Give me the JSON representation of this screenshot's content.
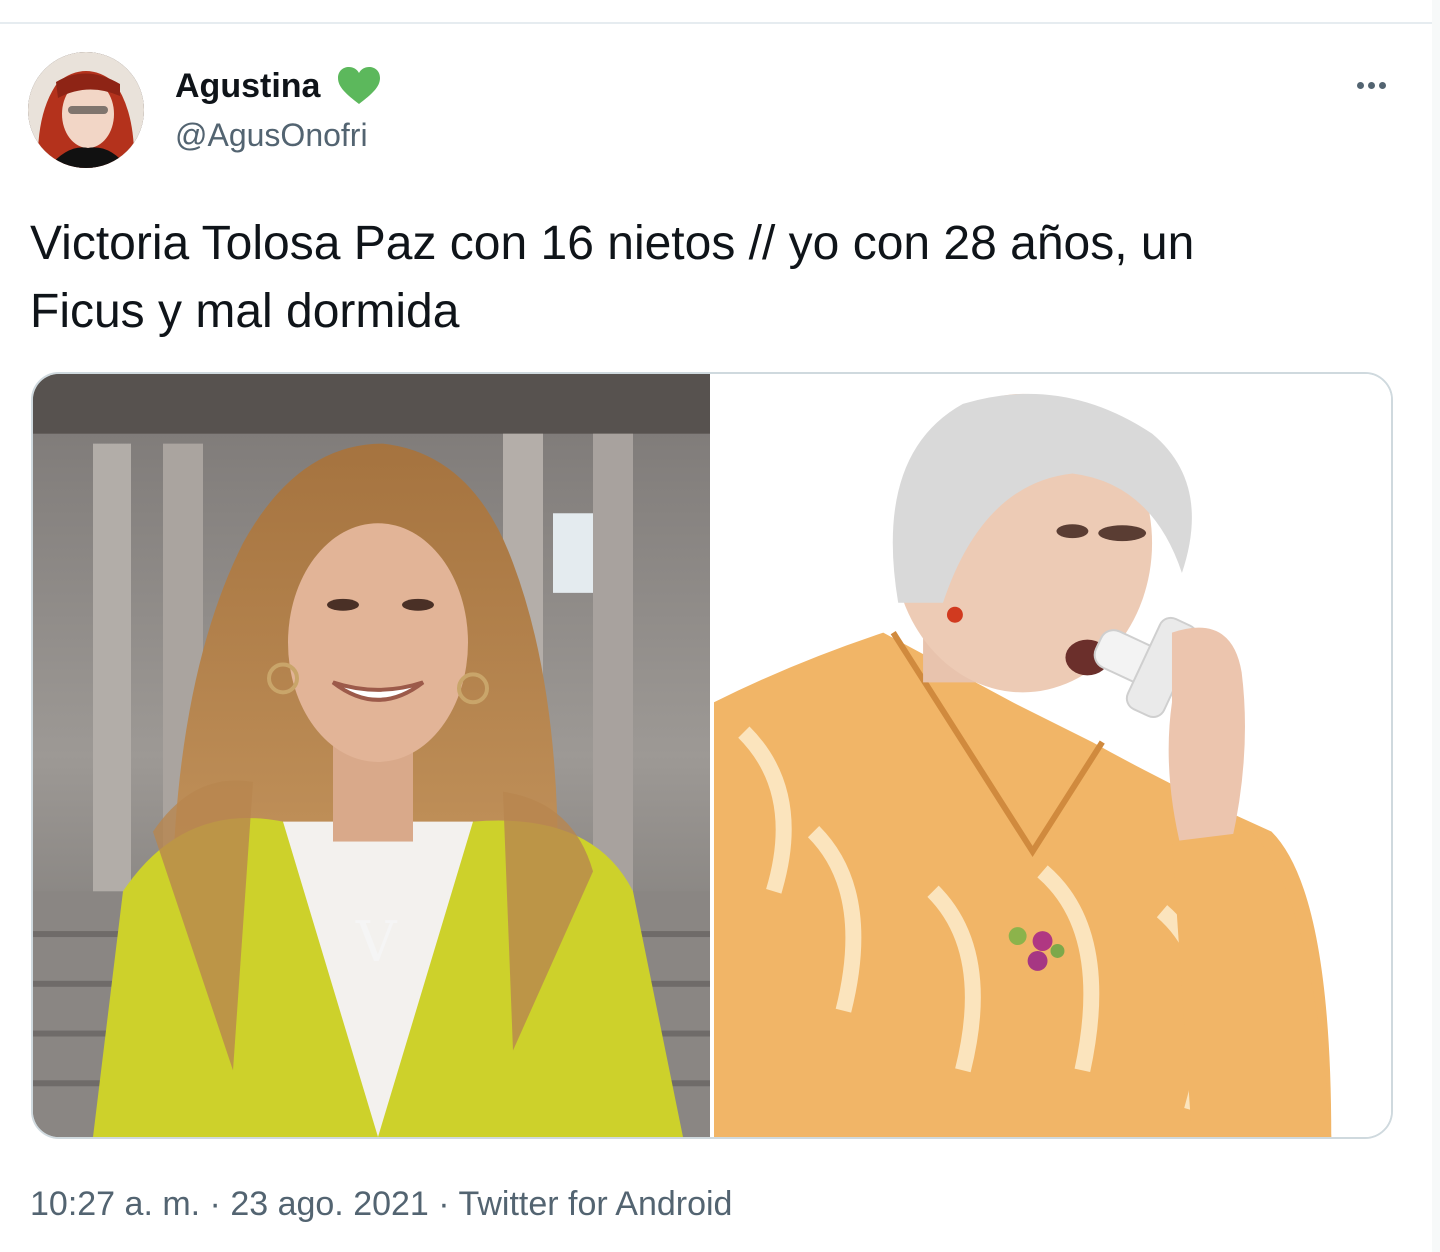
{
  "tweet": {
    "author": {
      "display_name": "Agustina",
      "badge_icon": "green-heart-icon",
      "handle": "@AgusOnofri"
    },
    "more_icon": "more-dots-icon",
    "text": "Victoria Tolosa Paz con 16 nietos // yo con 28 años, un\nFicus y mal dormida",
    "media": [
      {
        "name": "photo-smiling-woman-yellow-blazer",
        "monogram": "V"
      },
      {
        "name": "photo-elderly-woman-inhaler"
      }
    ],
    "timestamp": "10:27 a. m. · 23 ago. 2021",
    "separator": " · ",
    "source": "Twitter for Android"
  },
  "colors": {
    "text": "#0f1419",
    "secondary": "#536471",
    "border": "#cfd9de",
    "heart": "#5cb85c"
  }
}
